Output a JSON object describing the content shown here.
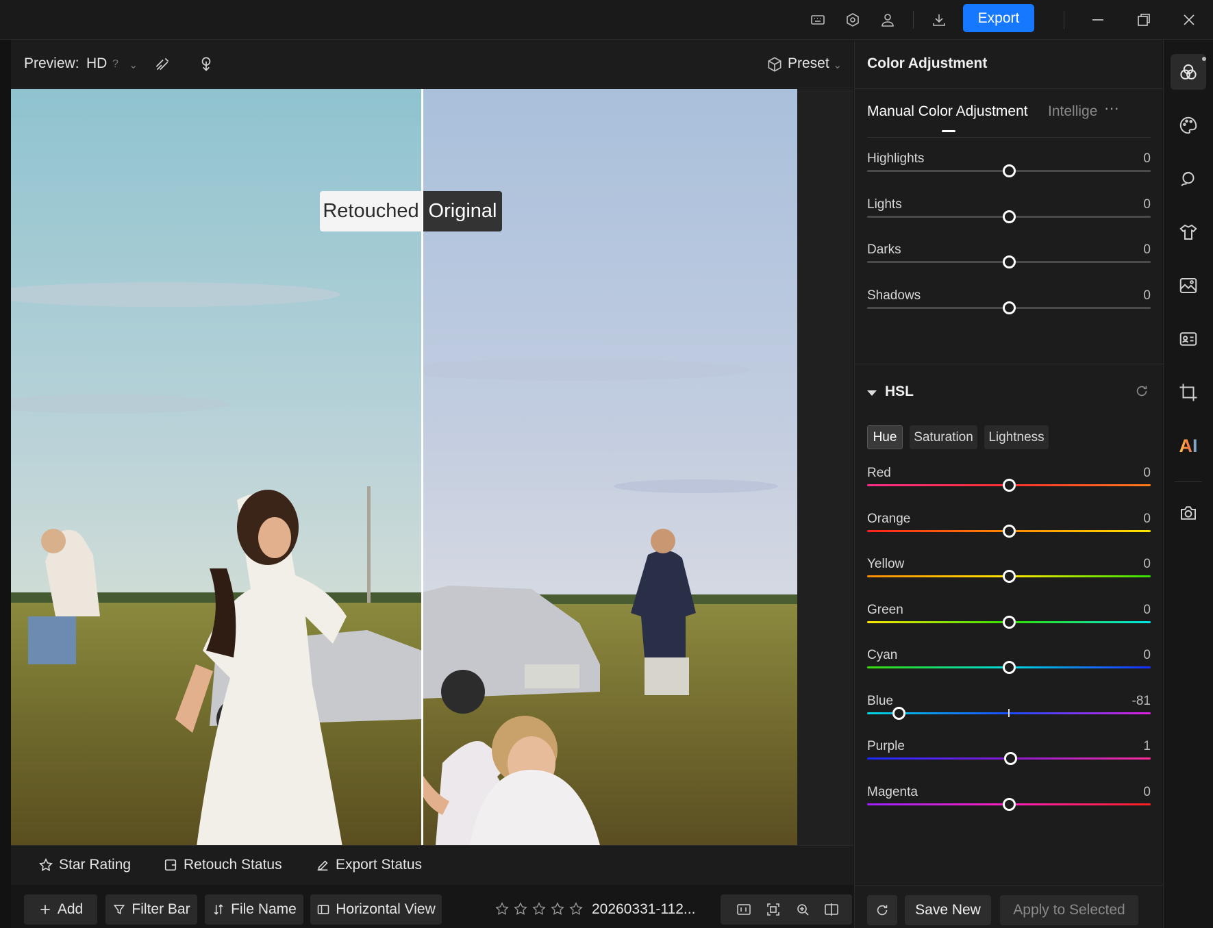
{
  "titlebar": {
    "export_label": "Export",
    "icons": [
      "keyboard-icon",
      "settings-hexagon-icon",
      "account-icon",
      "download-icon",
      "minimize-icon",
      "restore-icon",
      "close-icon"
    ]
  },
  "preview_toolbar": {
    "preview_label": "Preview:",
    "quality": "HD",
    "preset_label": "Preset"
  },
  "canvas": {
    "retouched_label": "Retouched",
    "original_label": "Original"
  },
  "status_bar": {
    "star_rating": "Star Rating",
    "retouch_status": "Retouch Status",
    "export_status": "Export Status"
  },
  "bottom_bar": {
    "add": "Add",
    "filter_bar": "Filter Bar",
    "file_name_sort": "File Name",
    "view_mode": "Horizontal View",
    "file_name": "20260331-112...",
    "rating": 0,
    "rating_max": 5
  },
  "right_panel": {
    "title": "Color Adjustment",
    "tabs": {
      "active": "Manual Color Adjustment",
      "other": "Intellige",
      "more": "···"
    },
    "tone": [
      {
        "label": "Highlights",
        "value": "0",
        "pos": 0.5
      },
      {
        "label": "Lights",
        "value": "0",
        "pos": 0.5
      },
      {
        "label": "Darks",
        "value": "0",
        "pos": 0.5
      },
      {
        "label": "Shadows",
        "value": "0",
        "pos": 0.5
      }
    ],
    "hsl": {
      "title": "HSL",
      "modes": [
        "Hue",
        "Saturation",
        "Lightness"
      ],
      "active_mode": "Hue",
      "channels": [
        {
          "label": "Red",
          "value": "0",
          "pos": 0.5,
          "gradient": [
            "#ff2d8a",
            "#ff3030",
            "#ff7a1a"
          ]
        },
        {
          "label": "Orange",
          "value": "0",
          "pos": 0.5,
          "gradient": [
            "#ff2020",
            "#ff8a00",
            "#ffe600"
          ]
        },
        {
          "label": "Yellow",
          "value": "0",
          "pos": 0.5,
          "gradient": [
            "#ff8a00",
            "#ffe600",
            "#34e000"
          ]
        },
        {
          "label": "Green",
          "value": "0",
          "pos": 0.5,
          "gradient": [
            "#ffe600",
            "#34e000",
            "#00e6e6"
          ]
        },
        {
          "label": "Cyan",
          "value": "0",
          "pos": 0.5,
          "gradient": [
            "#34e000",
            "#00d8e0",
            "#1a2cff"
          ]
        },
        {
          "label": "Blue",
          "value": "-81",
          "pos": 0.112,
          "gradient": [
            "#00d8e0",
            "#1a4cff",
            "#e020e0"
          ]
        },
        {
          "label": "Purple",
          "value": "1",
          "pos": 0.505,
          "gradient": [
            "#1a2cff",
            "#8a1ad8",
            "#ff2da0"
          ]
        },
        {
          "label": "Magenta",
          "value": "0",
          "pos": 0.5,
          "gradient": [
            "#a020ff",
            "#ff20c0",
            "#ff2020"
          ]
        }
      ]
    },
    "footer": {
      "save_new": "Save New",
      "apply_selected": "Apply to Selected"
    }
  },
  "rail": {
    "ai_label": "AI",
    "icons": [
      "color-adjust-icon",
      "palette-ai-icon",
      "portrait-retouch-icon",
      "clothing-icon",
      "background-image-icon",
      "id-photo-icon",
      "crop-icon",
      "ai-icon",
      "camera-icon"
    ]
  }
}
